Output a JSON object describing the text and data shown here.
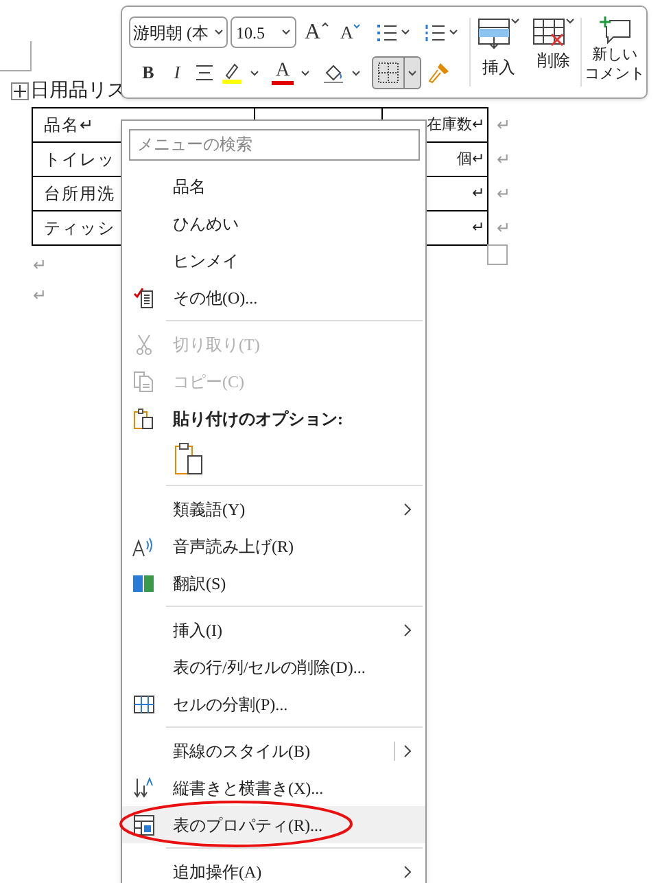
{
  "document": {
    "title": "日用品リス",
    "table": {
      "rows": [
        {
          "cells": [
            "品名↵",
            "在庫数↵"
          ],
          "end": "↵"
        },
        {
          "cells": [
            "トイレッ",
            "個↵"
          ],
          "end": "↵"
        },
        {
          "cells": [
            "台所用洗",
            "↵"
          ],
          "end": "↵"
        },
        {
          "cells": [
            "ティッシ",
            "↵"
          ],
          "end": "↵"
        }
      ]
    },
    "paragraphs": [
      "↵",
      "↵"
    ]
  },
  "mini_toolbar": {
    "font": "游明朝 (本",
    "size": "10.5",
    "grow_font": "A",
    "shrink_font": "A",
    "bold": "B",
    "italic": "I",
    "font_color": "A",
    "insert": "挿入",
    "delete": "削除",
    "new_comment": [
      "新しい",
      "コメント"
    ]
  },
  "context_menu": {
    "search": {
      "placeholder": "メニューの検索"
    },
    "items": [
      {
        "kind": "item",
        "label": "品名",
        "disabled": false,
        "submenu": false,
        "selected": false
      },
      {
        "kind": "item",
        "label": "ひんめい",
        "disabled": false,
        "submenu": false,
        "selected": false
      },
      {
        "kind": "item",
        "label": "ヒンメイ",
        "disabled": false,
        "submenu": false,
        "selected": false
      },
      {
        "kind": "item",
        "label": "その他(O)...",
        "disabled": false,
        "submenu": false,
        "selected": false
      },
      {
        "kind": "separator"
      },
      {
        "kind": "item",
        "label": "切り取り(T)",
        "disabled": true,
        "submenu": false,
        "selected": false
      },
      {
        "kind": "item",
        "label": "コピー(C)",
        "disabled": true,
        "submenu": false,
        "selected": false
      },
      {
        "kind": "header",
        "label": "貼り付けのオプション:"
      },
      {
        "kind": "paste"
      },
      {
        "kind": "separator"
      },
      {
        "kind": "item",
        "label": "類義語(Y)",
        "disabled": false,
        "submenu": true,
        "selected": false
      },
      {
        "kind": "item",
        "label": "音声読み上げ(R)",
        "disabled": false,
        "submenu": false,
        "selected": false
      },
      {
        "kind": "item",
        "label": "翻訳(S)",
        "disabled": false,
        "submenu": false,
        "selected": false
      },
      {
        "kind": "separator"
      },
      {
        "kind": "item",
        "label": "挿入(I)",
        "disabled": false,
        "submenu": true,
        "selected": false
      },
      {
        "kind": "item",
        "label": "表の行/列/セルの削除(D)...",
        "disabled": false,
        "submenu": false,
        "selected": false
      },
      {
        "kind": "item",
        "label": "セルの分割(P)...",
        "disabled": false,
        "submenu": false,
        "selected": false
      },
      {
        "kind": "separator"
      },
      {
        "kind": "split",
        "label": "罫線のスタイル(B)",
        "disabled": false,
        "submenu": true,
        "selected": false
      },
      {
        "kind": "item",
        "label": "縦書きと横書き(X)...",
        "disabled": false,
        "submenu": false,
        "selected": false
      },
      {
        "kind": "item",
        "label": "表のプロパティ(R)...",
        "disabled": false,
        "submenu": false,
        "selected": true
      },
      {
        "kind": "separator"
      },
      {
        "kind": "item",
        "label": "追加操作(A)",
        "disabled": false,
        "submenu": true,
        "selected": false
      }
    ]
  }
}
